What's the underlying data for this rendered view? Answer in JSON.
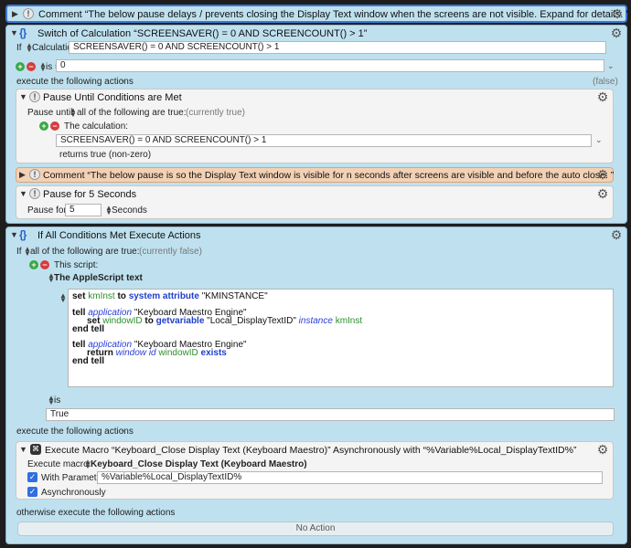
{
  "comment1": {
    "title": "Comment “The below pause delays / prevents closing the Display Text window when the screens are not visible. Expand for details. ”"
  },
  "switch": {
    "title": "Switch of Calculation “SCREENSAVER() = 0 AND SCREENCOUNT() > 1”",
    "if_label": "If",
    "calc_label": "Calculation",
    "calc_value": "SCREENSAVER() = 0 AND SCREENCOUNT() > 1",
    "is_label": "is =",
    "is_value": "0",
    "execute_label": "execute the following actions",
    "false_label": "(false)",
    "pause_until": {
      "title": "Pause Until Conditions are Met",
      "pause_until_label": "Pause until",
      "condition_select": "all of the following are true:",
      "status": "(currently true)",
      "calc_heading": "The calculation:",
      "calc_value": "SCREENSAVER() = 0 AND SCREENCOUNT() > 1",
      "returns": "returns true (non-zero)"
    },
    "comment2": {
      "title": "Comment “The below pause is so the Display Text window is visible for n seconds after screens are visible and before the auto close. ”"
    },
    "pause": {
      "title": "Pause for 5 Seconds",
      "pause_for_label": "Pause for",
      "value": "5",
      "unit": "Seconds"
    }
  },
  "ifall": {
    "title": "If All Conditions Met Execute Actions",
    "if_label": "If",
    "condition_select": "all of the following are true:",
    "status": "(currently false)",
    "script_label": "This script:",
    "script_type": "The AppleScript text",
    "code": {
      "l1": {
        "a": "set ",
        "b": "kmInst",
        "c": " to ",
        "d": "system attribute",
        "e": " \"KMINSTANCE\""
      },
      "l3": {
        "a": "tell ",
        "b": "application",
        "c": " \"Keyboard Maestro Engine\""
      },
      "l4": {
        "a": "set ",
        "b": "windowID",
        "c": " to ",
        "d": "getvariable",
        "e": " \"Local_DisplayTextID\" ",
        "f": "instance",
        "g": " kmInst"
      },
      "l5": {
        "a": "end tell"
      },
      "l7": {
        "a": "tell ",
        "b": "application",
        "c": " \"Keyboard Maestro Engine\""
      },
      "l8": {
        "a": "return ",
        "b": "window",
        "c": " ",
        "d": "id",
        "e": " windowID ",
        "f": "exists"
      },
      "l9": {
        "a": "end tell"
      }
    },
    "is_label": "is",
    "is_value": "True",
    "execute_label": "execute the following actions",
    "exec_macro": {
      "title": "Execute Macro “Keyboard_Close Display Text (Keyboard Maestro)” Asynchronously with “%Variable%Local_DisplayTextID%”",
      "macro_label": "Execute macro:",
      "macro_value": "Keyboard_Close Display Text (Keyboard Maestro)",
      "with_param_label": "With Parameter",
      "param_value": "%Variable%Local_DisplayTextID%",
      "async_label": "Asynchronously"
    },
    "otherwise_label": "otherwise execute the following actions",
    "no_action": "No Action"
  }
}
